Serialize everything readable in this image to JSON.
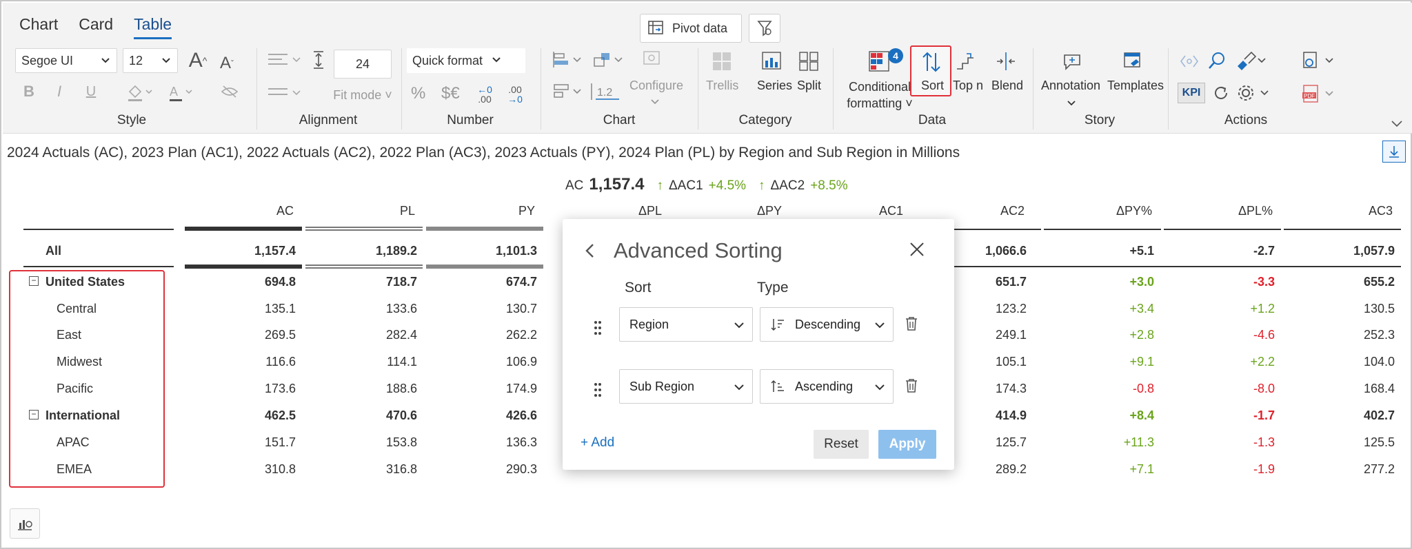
{
  "tabs": [
    "Chart",
    "Card",
    "Table"
  ],
  "active_tab": "Table",
  "pivot_label": "Pivot data",
  "style": {
    "font_family": "Segoe UI",
    "font_size": "12",
    "label": "Style"
  },
  "alignment": {
    "size_value": "24",
    "fit_mode": "Fit mode",
    "label": "Alignment"
  },
  "number": {
    "quick_format": "Quick format",
    "percent": "%",
    "currency": "$€",
    "dec_left": ".00",
    "dec_right": ".00",
    "label": "Number"
  },
  "chart": {
    "value_12": "1.2",
    "configure": "Configure",
    "label": "Chart"
  },
  "category": {
    "trellis": "Trellis",
    "series": "Series",
    "split": "Split",
    "label": "Category"
  },
  "data": {
    "conditional": "Conditional",
    "formatting": "formatting",
    "badge": "4",
    "sort": "Sort",
    "topn": "Top n",
    "blend": "Blend",
    "label": "Data"
  },
  "story": {
    "annotation": "Annotation",
    "templates": "Templates",
    "label": "Story"
  },
  "actions": {
    "kpi": "KPI",
    "pdf": "PDF",
    "label": "Actions"
  },
  "subtitle": "2024 Actuals (AC), 2023 Plan (AC1), 2022 Actuals (AC2), 2022 Plan (AC3), 2023 Actuals (PY), 2024 Plan (PL) by Region and Sub Region in Millions",
  "kpi": {
    "label": "AC",
    "value": "1,157.4",
    "d1_label": "ΔAC1",
    "d1_value": "+4.5%",
    "d2_label": "ΔAC2",
    "d2_value": "+8.5%"
  },
  "columns": [
    "AC",
    "PL",
    "PY",
    "ΔPL",
    "ΔPY",
    "AC1",
    "AC2",
    "ΔPY%",
    "ΔPL%",
    "AC3"
  ],
  "rows": [
    {
      "label": "All",
      "AC": "1,157.4",
      "PL": "1,189.2",
      "PY": "1,101.3",
      "AC2": "1,066.6",
      "dPYp": "+5.1",
      "dPLp": "-2.7",
      "AC3": "1,057.9"
    },
    {
      "label": "United States",
      "AC": "694.8",
      "PL": "718.7",
      "PY": "674.7",
      "AC2": "651.7",
      "dPYp": "+3.0",
      "dPLp": "-3.3",
      "AC3": "655.2"
    },
    {
      "label": "Central",
      "AC": "135.1",
      "PL": "133.6",
      "PY": "130.7",
      "AC2": "123.2",
      "dPYp": "+3.4",
      "dPLp": "+1.2",
      "AC3": "130.5"
    },
    {
      "label": "East",
      "AC": "269.5",
      "PL": "282.4",
      "PY": "262.2",
      "AC2": "249.1",
      "dPYp": "+2.8",
      "dPLp": "-4.6",
      "AC3": "252.3"
    },
    {
      "label": "Midwest",
      "AC": "116.6",
      "PL": "114.1",
      "PY": "106.9",
      "AC2": "105.1",
      "dPYp": "+9.1",
      "dPLp": "+2.2",
      "AC3": "104.0"
    },
    {
      "label": "Pacific",
      "AC": "173.6",
      "PL": "188.6",
      "PY": "174.9",
      "AC2": "174.3",
      "dPYp": "-0.8",
      "dPLp": "-8.0",
      "AC3": "168.4"
    },
    {
      "label": "International",
      "AC": "462.5",
      "PL": "470.6",
      "PY": "426.6",
      "AC2": "414.9",
      "dPYp": "+8.4",
      "dPLp": "-1.7",
      "AC3": "402.7"
    },
    {
      "label": "APAC",
      "AC": "151.7",
      "PL": "153.8",
      "PY": "136.3",
      "AC2": "125.7",
      "dPYp": "+11.3",
      "dPLp": "-1.3",
      "AC3": "125.5"
    },
    {
      "label": "EMEA",
      "AC": "310.8",
      "PL": "316.8",
      "PY": "290.3",
      "AC2": "289.2",
      "dPYp": "+7.1",
      "dPLp": "-1.9",
      "AC3": "277.2"
    }
  ],
  "dialog": {
    "title": "Advanced Sorting",
    "sort_header": "Sort",
    "type_header": "Type",
    "rule1_field": "Region",
    "rule1_type": "Descending",
    "rule2_field": "Sub Region",
    "rule2_type": "Ascending",
    "add": "+ Add",
    "reset": "Reset",
    "apply": "Apply"
  },
  "colors": {
    "positive": "#6aa31b",
    "negative": "#e0202a",
    "accent": "#1a6fc0",
    "highlight": "#e0303a"
  }
}
